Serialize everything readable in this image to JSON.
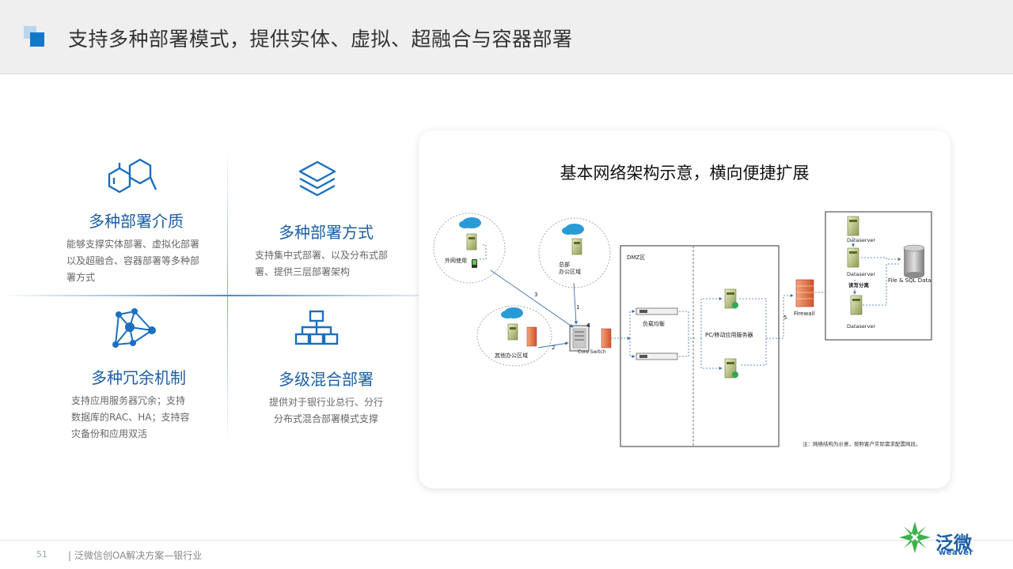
{
  "header": {
    "title": "支持多种部署模式，提供实体、虚拟、超融合与容器部署"
  },
  "features": [
    {
      "title": "多种部署介质",
      "desc_lines": [
        "能够支撑实体部署、虚拟化部署",
        "以及超融合、容器部署等多种部",
        "署方式"
      ]
    },
    {
      "title": "多种部署方式",
      "desc_lines": [
        "支持集中式部署、以及分布式部",
        "署、提供三层部署架构"
      ]
    },
    {
      "title": "多种冗余机制",
      "desc_lines": [
        "支持应用服务器冗余；支持",
        "数据库的RAC、HA；支持容",
        "灾备份和应用双活"
      ]
    },
    {
      "title": "多级混合部署",
      "desc_lines": [
        "提供对于银行业总行、分行",
        "分布式混合部署模式支撑"
      ]
    }
  ],
  "diagram": {
    "title": "基本网络架构示意，横向便捷扩展",
    "labels": {
      "external": "外网使用",
      "hq_line1": "总部",
      "hq_line2": "办公区域",
      "other": "其他办公区域",
      "dmz": "DMZ区",
      "lb": "负载均衡",
      "app_server": "PC/移动应用服务器",
      "firewall": "Firewall",
      "core_switch": "Core Switch",
      "dataserver": "Dataserver",
      "rw_split": "读写分离",
      "file_sql": "File & SQL Data",
      "note": "注：网络结构为示意，按照客户实际需求配置网段。"
    },
    "numbers": [
      "1",
      "2",
      "3",
      "4",
      "4",
      "5"
    ]
  },
  "footer": {
    "page_number": "51",
    "text": "| 泛微信创OA解决方案—银行业"
  },
  "logo": {
    "name": "泛微",
    "sub": "weaver"
  },
  "colors": {
    "accent": "#1478c8",
    "feature_title": "#1b5fa6",
    "logo_green": "#3bb34a"
  }
}
